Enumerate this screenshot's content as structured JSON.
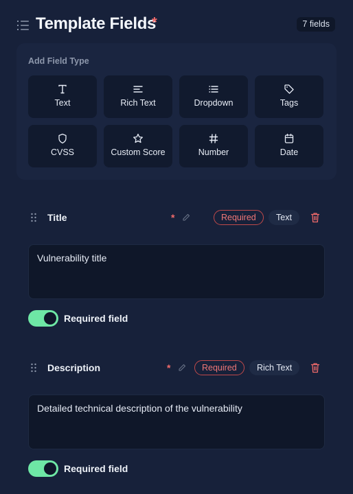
{
  "header": {
    "title": "Template Fields",
    "required_marker": "*",
    "field_count": "7 fields"
  },
  "palette": {
    "label": "Add Field Type",
    "types": [
      {
        "label": "Text",
        "icon": "text-type-icon"
      },
      {
        "label": "Rich Text",
        "icon": "align-left-icon"
      },
      {
        "label": "Dropdown",
        "icon": "list-icon"
      },
      {
        "label": "Tags",
        "icon": "tag-icon"
      },
      {
        "label": "CVSS",
        "icon": "shield-icon"
      },
      {
        "label": "Custom Score",
        "icon": "star-icon"
      },
      {
        "label": "Number",
        "icon": "hash-icon"
      },
      {
        "label": "Date",
        "icon": "calendar-icon"
      }
    ]
  },
  "fields": [
    {
      "name": "Title",
      "required_marker": "*",
      "required_badge": "Required",
      "type_badge": "Text",
      "value": "Vulnerability title",
      "toggle_label": "Required field",
      "required": true
    },
    {
      "name": "Description",
      "required_marker": "*",
      "required_badge": "Required",
      "type_badge": "Rich Text",
      "value": "Detailed technical description of the vulnerability",
      "toggle_label": "Required field",
      "required": true
    }
  ],
  "colors": {
    "background": "#17213a",
    "panel": "#1a2540",
    "button": "#111a2e",
    "required_red": "#f26b6b",
    "toggle_on": "#6ee7a5"
  }
}
